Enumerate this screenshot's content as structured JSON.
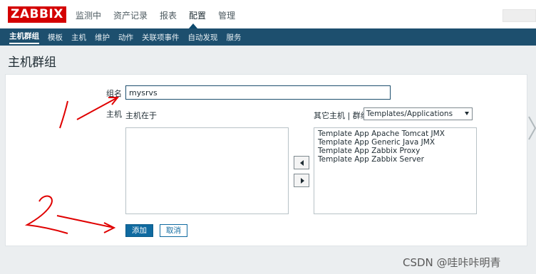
{
  "brand": {
    "logo_text": "ZABBIX",
    "logo_color": "#d40000"
  },
  "main_menu": [
    {
      "label": "监测中"
    },
    {
      "label": "资产记录"
    },
    {
      "label": "报表"
    },
    {
      "label": "配置",
      "active": true
    },
    {
      "label": "管理"
    }
  ],
  "sub_menu": [
    {
      "label": "主机群组",
      "active": true
    },
    {
      "label": "模板"
    },
    {
      "label": "主机"
    },
    {
      "label": "维护"
    },
    {
      "label": "动作"
    },
    {
      "label": "关联项事件"
    },
    {
      "label": "自动发现"
    },
    {
      "label": "服务"
    }
  ],
  "page": {
    "title": "主机群组"
  },
  "form": {
    "group_name_label": "组名",
    "group_name_value": "mysrvs",
    "hosts_label": "主机",
    "in_hosts_label": "主机在于",
    "in_hosts": [],
    "other_hosts_label": "其它主机 | 群组",
    "group_select_value": "Templates/Applications",
    "other_hosts": [
      "Template App Apache Tomcat JMX",
      "Template App Generic Java JMX",
      "Template App Zabbix Proxy",
      "Template App Zabbix Server"
    ],
    "add_button": "添加",
    "cancel_button": "取消"
  },
  "annotations": {
    "mark_1": "1",
    "mark_2": "2",
    "color": "#e00000"
  },
  "watermark": "CSDN @哇咔咔明青",
  "colors": {
    "header_bar": "#1d4f6e",
    "primary_button": "#0f6aa0",
    "background": "#ebeef0"
  }
}
